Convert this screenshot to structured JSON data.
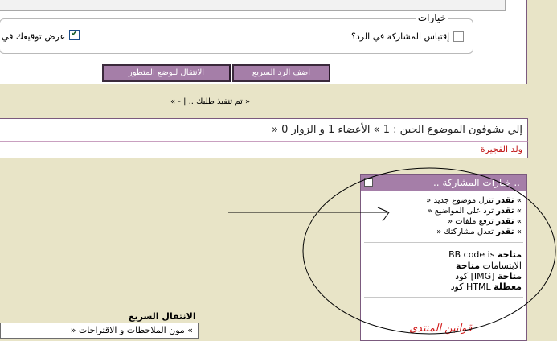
{
  "options": {
    "legend": "خيارات",
    "quote_label": "إقتباس المشاركة في الرد؟",
    "quote_checked": false,
    "signature_label": "عرض توقيعك في",
    "signature_checked": true
  },
  "buttons": {
    "quick_reply": "اضف الرد السريع",
    "advanced_mode": "الانتقال للوضع المتطور"
  },
  "breadcrumb": "« تم تنفيذ طلبك .. | - »",
  "viewers": {
    "text": "إلي يشوفون الموضوع الحين : 1 » الأعضاء 1 و الزوار 0 «",
    "user": "ولد الفجيرة"
  },
  "permissions": {
    "title": ".. خيارات المشاركة ..",
    "lines": [
      {
        "prefix": "» ",
        "bold": "تقدر",
        "text": " تنزل موضوع جديد «"
      },
      {
        "prefix": "» ",
        "bold": "تقدر",
        "text": " ترد على المواضيع «"
      },
      {
        "prefix": "» ",
        "bold": "تقدر",
        "text": " ترفع ملفات «"
      },
      {
        "prefix": "» ",
        "bold": "تقدر",
        "text": " تعدل مشاركتك «"
      }
    ],
    "codes": [
      {
        "label": "BB code is",
        "status": "متاحة"
      },
      {
        "label": "الابتسامات",
        "status": "متاحة"
      },
      {
        "label": "كود [IMG]",
        "status": "متاحة"
      },
      {
        "label": "كود HTML",
        "status": "معطلة"
      }
    ],
    "rules_link": "قوانين المنتدى"
  },
  "jump": {
    "label": "الانتقال السريع",
    "selected": "» مون الملاحظات و الاقتراحات «"
  }
}
